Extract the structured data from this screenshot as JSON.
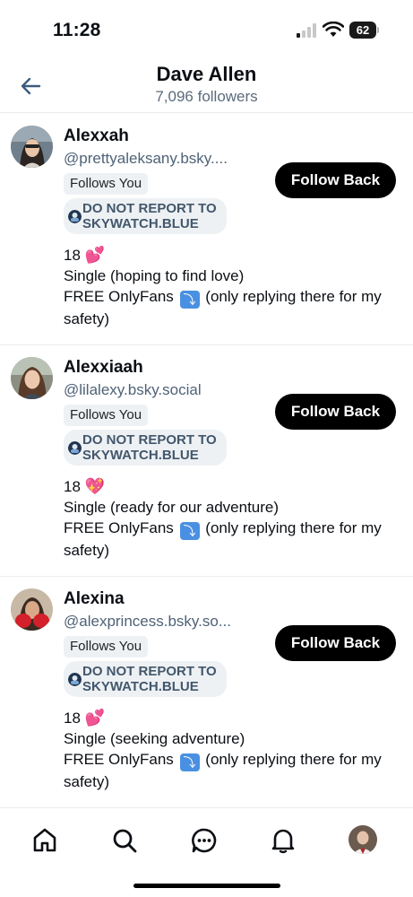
{
  "status_bar": {
    "time": "11:28",
    "battery": "62",
    "icons": [
      "signal-icon",
      "wifi-icon",
      "battery-icon"
    ]
  },
  "header": {
    "back_icon": "arrow-left-icon",
    "title": "Dave Allen",
    "subtitle": "7,096 followers"
  },
  "follow_back_label": "Follow Back",
  "follows_you_label": "Follows You",
  "label_chip": "DO NOT REPORT TO SKYWATCH.BLUE",
  "followers": [
    {
      "name": "Alexxah",
      "handle": "@prettyaleksany.bsky....",
      "bio_age": "18",
      "bio_status": "Single (hoping to find love)",
      "bio_free": "FREE OnlyFans",
      "bio_rest": "(only replying there for my safety)"
    },
    {
      "name": "Alexxiaah",
      "handle": "@lilalexy.bsky.social",
      "bio_age": "18",
      "bio_status": "Single (ready for our adventure)",
      "bio_free": "FREE OnlyFans",
      "bio_rest": "(only replying there for my safety)"
    },
    {
      "name": "Alexina",
      "handle": "@alexprincess.bsky.so...",
      "bio_age": "18",
      "bio_status": "Single (seeking adventure)",
      "bio_free": "FREE OnlyFans",
      "bio_rest": "(only replying there for my safety)"
    }
  ],
  "bottom_nav": {
    "items": [
      "home-icon",
      "search-icon",
      "chat-icon",
      "bell-icon",
      "profile-avatar"
    ]
  },
  "colors": {
    "accent": "#000000",
    "chip_bg": "#eef1f4",
    "handle": "#4f6277",
    "divider": "#e9ecef",
    "heart": "#e24694",
    "arrow_emoji": "#4a90e2"
  }
}
